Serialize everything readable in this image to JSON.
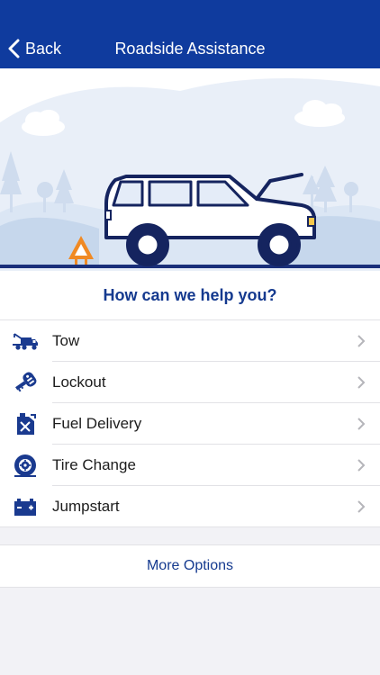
{
  "navbar": {
    "back_label": "Back",
    "title": "Roadside Assistance"
  },
  "prompt": "How can we help you?",
  "options": [
    {
      "label": "Tow",
      "icon": "tow-truck-icon"
    },
    {
      "label": "Lockout",
      "icon": "car-key-icon"
    },
    {
      "label": "Fuel Delivery",
      "icon": "fuel-can-icon"
    },
    {
      "label": "Tire Change",
      "icon": "tire-icon"
    },
    {
      "label": "Jumpstart",
      "icon": "battery-icon"
    }
  ],
  "more_options_label": "More Options",
  "colors": {
    "brand_blue": "#0f3b9e",
    "text_blue": "#153a8f",
    "warning_orange": "#f08a24"
  }
}
